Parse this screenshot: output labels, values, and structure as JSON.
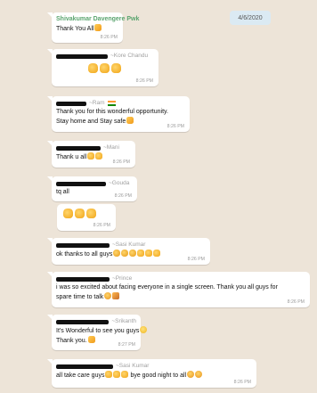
{
  "date_chip": "4/6/2020",
  "messages": [
    {
      "sender_name": "Shivakumar Davengere Pwk",
      "text": "Thank You All",
      "time": "8:26 PM"
    },
    {
      "sender_name": "~Kore Chandu",
      "text": "",
      "time": "8:26 PM"
    },
    {
      "sender_name": "~Ram",
      "line1": "Thank you for this wonderful opportunity.",
      "line2": "Stay home and Stay safe",
      "time": "8:26 PM"
    },
    {
      "sender_name": "~Mani",
      "text": "Thank u all",
      "time": "8:26 PM"
    },
    {
      "sender_name": "~Gouda",
      "text": "tq all",
      "time": "8:26 PM"
    },
    {
      "sender_name": "",
      "text": "",
      "time": "8:26 PM"
    },
    {
      "sender_name": "~Sasi Kumar",
      "text": "ok thanks to all guys",
      "time": "8:26 PM"
    },
    {
      "sender_name": "~Prince",
      "line1": "i was so excited about facing everyone in a single screen.  Thank you all guys for",
      "line2": "spare time to talk",
      "time": "8:26 PM"
    },
    {
      "sender_name": "~Srikanth",
      "line1": "It's Wonderful to see you guys",
      "line2": "Thank you.",
      "time": "8:27 PM"
    },
    {
      "sender_name": "~Sasi Kumar",
      "text": "all take care guys",
      "text2": "bye good night to all",
      "time": "8:26 PM"
    }
  ],
  "icons": {
    "thumbs_up": "thumbs-up-icon",
    "pray": "folded-hands-icon",
    "clap": "clapping-hands-icon",
    "smile": "smiling-face-icon",
    "party": "party-face-icon",
    "family": "family-icon",
    "flag": "india-flag-icon"
  },
  "colors": {
    "background": "#ede4d8",
    "bubble": "#ffffff",
    "sender_named": "#5aa46e",
    "sender_phone": "#a0a0a0",
    "date_chip": "#dbeaf3"
  }
}
